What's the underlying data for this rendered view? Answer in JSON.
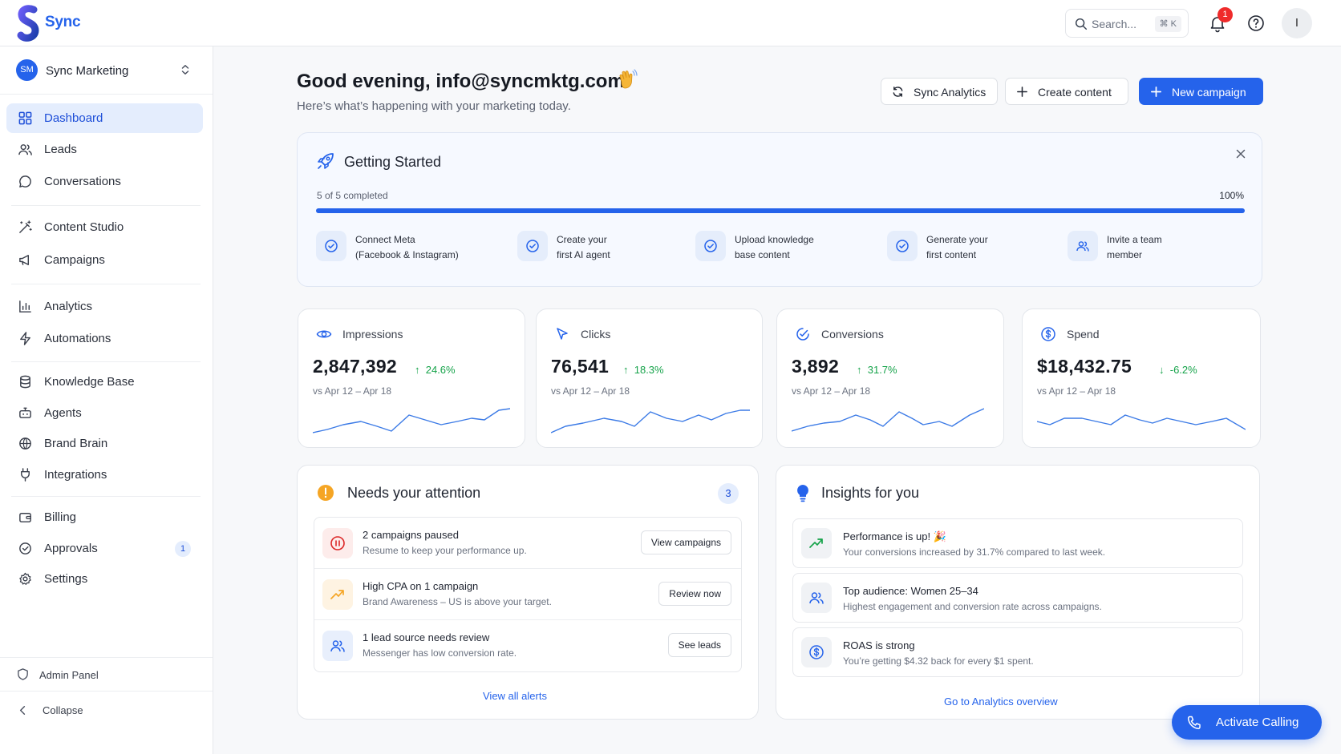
{
  "app": {
    "name": "Sync"
  },
  "header": {
    "search_placeholder": "Search...",
    "search_shortcut": "⌘ K",
    "notification_count": "1",
    "avatar_initial": "I"
  },
  "workspace": {
    "initials": "SM",
    "name": "Sync Marketing"
  },
  "sidebar": {
    "items": [
      {
        "label": "Dashboard",
        "icon": "grid-icon",
        "active": true
      },
      {
        "label": "Leads",
        "icon": "users-icon"
      },
      {
        "label": "Conversations",
        "icon": "message-icon"
      },
      {
        "label": "Content Studio",
        "icon": "magic-wand-icon"
      },
      {
        "label": "Campaigns",
        "icon": "megaphone-icon"
      },
      {
        "label": "Analytics",
        "icon": "bar-chart-icon"
      },
      {
        "label": "Automations",
        "icon": "lightning-icon"
      },
      {
        "label": "Knowledge Base",
        "icon": "database-icon"
      },
      {
        "label": "Agents",
        "icon": "bot-icon"
      },
      {
        "label": "Brand Brain",
        "icon": "globe-icon"
      },
      {
        "label": "Integrations",
        "icon": "plug-icon"
      },
      {
        "label": "Billing",
        "icon": "wallet-icon"
      },
      {
        "label": "Approvals",
        "icon": "check-circle-icon",
        "badge": "1"
      },
      {
        "label": "Settings",
        "icon": "gear-icon"
      }
    ],
    "admin_panel": "Admin Panel",
    "collapse": "Collapse"
  },
  "page": {
    "greeting": "Good evening, info@syncmktg.com",
    "subtitle": "Here’s what’s happening with your marketing today.",
    "actions": {
      "sync_analytics": "Sync Analytics",
      "create_content": "Create content",
      "new_campaign": "New campaign"
    }
  },
  "getting_started": {
    "title": "Getting Started",
    "count_text": "5 of 5 completed",
    "percent_text": "100%",
    "progress": 1.0,
    "steps": [
      {
        "line1": "Connect Meta",
        "line2": "(Facebook & Instagram)"
      },
      {
        "line1": "Create your",
        "line2": "first AI agent"
      },
      {
        "line1": "Upload knowledge",
        "line2": "base content"
      },
      {
        "line1": "Generate your",
        "line2": "first content"
      },
      {
        "line1": "Invite a team",
        "line2": "member"
      }
    ]
  },
  "kpis": [
    {
      "label": "Impressions",
      "value": "2,847,392",
      "delta": "24.6%",
      "comparison": "vs Apr 12 – Apr 18",
      "icon": "eye-icon"
    },
    {
      "label": "Clicks",
      "value": "76,541",
      "delta": "18.3%",
      "comparison": "vs Apr 12 – Apr 18",
      "icon": "cursor-icon"
    },
    {
      "label": "Conversions",
      "value": "3,892",
      "delta": "31.7%",
      "comparison": "vs Apr 12 – Apr 18",
      "icon": "target-icon"
    },
    {
      "label": "Spend",
      "value": "$18,432.75",
      "delta": "-6.2%",
      "comparison": "vs Apr 12 – Apr 18",
      "icon": "dollar-icon"
    }
  ],
  "attention": {
    "title": "Needs your attention",
    "count": "3",
    "items": [
      {
        "title": "2 campaigns paused",
        "desc": "Resume to keep your performance up.",
        "action": "View campaigns"
      },
      {
        "title": "High CPA on 1 campaign",
        "desc": "Brand Awareness – US is above your target.",
        "action": "Review now"
      },
      {
        "title": "1 lead source needs review",
        "desc": "Messenger has low conversion rate.",
        "action": "See leads"
      }
    ],
    "view_all": "View all alerts"
  },
  "insights": {
    "title": "Insights for you",
    "items": [
      {
        "title": "Performance is up! 🎉",
        "desc": "Your conversions increased by 31.7% compared to last week."
      },
      {
        "title": "Top audience: Women 25–34",
        "desc": "Highest engagement and conversion rate across campaigns."
      },
      {
        "title": "ROAS is strong",
        "desc": "You’re getting $4.32 back for every $1 spent."
      }
    ],
    "link": "Go to Analytics overview"
  },
  "call_button": "Activate Calling",
  "colors": {
    "accent": "#2563eb",
    "positive": "#16a34a",
    "warning": "#f5a524",
    "danger": "#dc2626"
  }
}
